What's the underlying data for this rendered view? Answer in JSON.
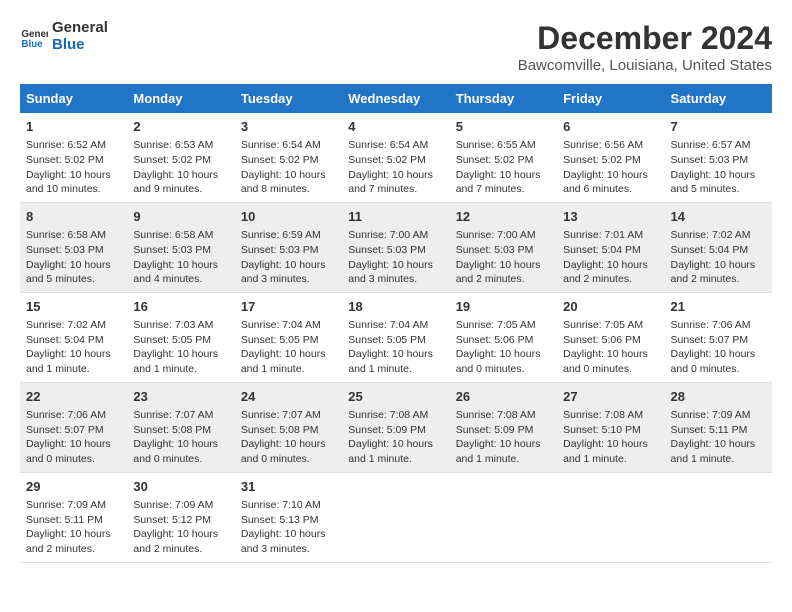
{
  "header": {
    "logo_line1": "General",
    "logo_line2": "Blue",
    "title": "December 2024",
    "subtitle": "Bawcomville, Louisiana, United States"
  },
  "calendar": {
    "days_of_week": [
      "Sunday",
      "Monday",
      "Tuesday",
      "Wednesday",
      "Thursday",
      "Friday",
      "Saturday"
    ],
    "rows": [
      [
        {
          "day": "1",
          "info": "Sunrise: 6:52 AM\nSunset: 5:02 PM\nDaylight: 10 hours\nand 10 minutes."
        },
        {
          "day": "2",
          "info": "Sunrise: 6:53 AM\nSunset: 5:02 PM\nDaylight: 10 hours\nand 9 minutes."
        },
        {
          "day": "3",
          "info": "Sunrise: 6:54 AM\nSunset: 5:02 PM\nDaylight: 10 hours\nand 8 minutes."
        },
        {
          "day": "4",
          "info": "Sunrise: 6:54 AM\nSunset: 5:02 PM\nDaylight: 10 hours\nand 7 minutes."
        },
        {
          "day": "5",
          "info": "Sunrise: 6:55 AM\nSunset: 5:02 PM\nDaylight: 10 hours\nand 7 minutes."
        },
        {
          "day": "6",
          "info": "Sunrise: 6:56 AM\nSunset: 5:02 PM\nDaylight: 10 hours\nand 6 minutes."
        },
        {
          "day": "7",
          "info": "Sunrise: 6:57 AM\nSunset: 5:03 PM\nDaylight: 10 hours\nand 5 minutes."
        }
      ],
      [
        {
          "day": "8",
          "info": "Sunrise: 6:58 AM\nSunset: 5:03 PM\nDaylight: 10 hours\nand 5 minutes."
        },
        {
          "day": "9",
          "info": "Sunrise: 6:58 AM\nSunset: 5:03 PM\nDaylight: 10 hours\nand 4 minutes."
        },
        {
          "day": "10",
          "info": "Sunrise: 6:59 AM\nSunset: 5:03 PM\nDaylight: 10 hours\nand 3 minutes."
        },
        {
          "day": "11",
          "info": "Sunrise: 7:00 AM\nSunset: 5:03 PM\nDaylight: 10 hours\nand 3 minutes."
        },
        {
          "day": "12",
          "info": "Sunrise: 7:00 AM\nSunset: 5:03 PM\nDaylight: 10 hours\nand 2 minutes."
        },
        {
          "day": "13",
          "info": "Sunrise: 7:01 AM\nSunset: 5:04 PM\nDaylight: 10 hours\nand 2 minutes."
        },
        {
          "day": "14",
          "info": "Sunrise: 7:02 AM\nSunset: 5:04 PM\nDaylight: 10 hours\nand 2 minutes."
        }
      ],
      [
        {
          "day": "15",
          "info": "Sunrise: 7:02 AM\nSunset: 5:04 PM\nDaylight: 10 hours\nand 1 minute."
        },
        {
          "day": "16",
          "info": "Sunrise: 7:03 AM\nSunset: 5:05 PM\nDaylight: 10 hours\nand 1 minute."
        },
        {
          "day": "17",
          "info": "Sunrise: 7:04 AM\nSunset: 5:05 PM\nDaylight: 10 hours\nand 1 minute."
        },
        {
          "day": "18",
          "info": "Sunrise: 7:04 AM\nSunset: 5:05 PM\nDaylight: 10 hours\nand 1 minute."
        },
        {
          "day": "19",
          "info": "Sunrise: 7:05 AM\nSunset: 5:06 PM\nDaylight: 10 hours\nand 0 minutes."
        },
        {
          "day": "20",
          "info": "Sunrise: 7:05 AM\nSunset: 5:06 PM\nDaylight: 10 hours\nand 0 minutes."
        },
        {
          "day": "21",
          "info": "Sunrise: 7:06 AM\nSunset: 5:07 PM\nDaylight: 10 hours\nand 0 minutes."
        }
      ],
      [
        {
          "day": "22",
          "info": "Sunrise: 7:06 AM\nSunset: 5:07 PM\nDaylight: 10 hours\nand 0 minutes."
        },
        {
          "day": "23",
          "info": "Sunrise: 7:07 AM\nSunset: 5:08 PM\nDaylight: 10 hours\nand 0 minutes."
        },
        {
          "day": "24",
          "info": "Sunrise: 7:07 AM\nSunset: 5:08 PM\nDaylight: 10 hours\nand 0 minutes."
        },
        {
          "day": "25",
          "info": "Sunrise: 7:08 AM\nSunset: 5:09 PM\nDaylight: 10 hours\nand 1 minute."
        },
        {
          "day": "26",
          "info": "Sunrise: 7:08 AM\nSunset: 5:09 PM\nDaylight: 10 hours\nand 1 minute."
        },
        {
          "day": "27",
          "info": "Sunrise: 7:08 AM\nSunset: 5:10 PM\nDaylight: 10 hours\nand 1 minute."
        },
        {
          "day": "28",
          "info": "Sunrise: 7:09 AM\nSunset: 5:11 PM\nDaylight: 10 hours\nand 1 minute."
        }
      ],
      [
        {
          "day": "29",
          "info": "Sunrise: 7:09 AM\nSunset: 5:11 PM\nDaylight: 10 hours\nand 2 minutes."
        },
        {
          "day": "30",
          "info": "Sunrise: 7:09 AM\nSunset: 5:12 PM\nDaylight: 10 hours\nand 2 minutes."
        },
        {
          "day": "31",
          "info": "Sunrise: 7:10 AM\nSunset: 5:13 PM\nDaylight: 10 hours\nand 3 minutes."
        },
        {
          "day": "",
          "info": ""
        },
        {
          "day": "",
          "info": ""
        },
        {
          "day": "",
          "info": ""
        },
        {
          "day": "",
          "info": ""
        }
      ]
    ]
  }
}
